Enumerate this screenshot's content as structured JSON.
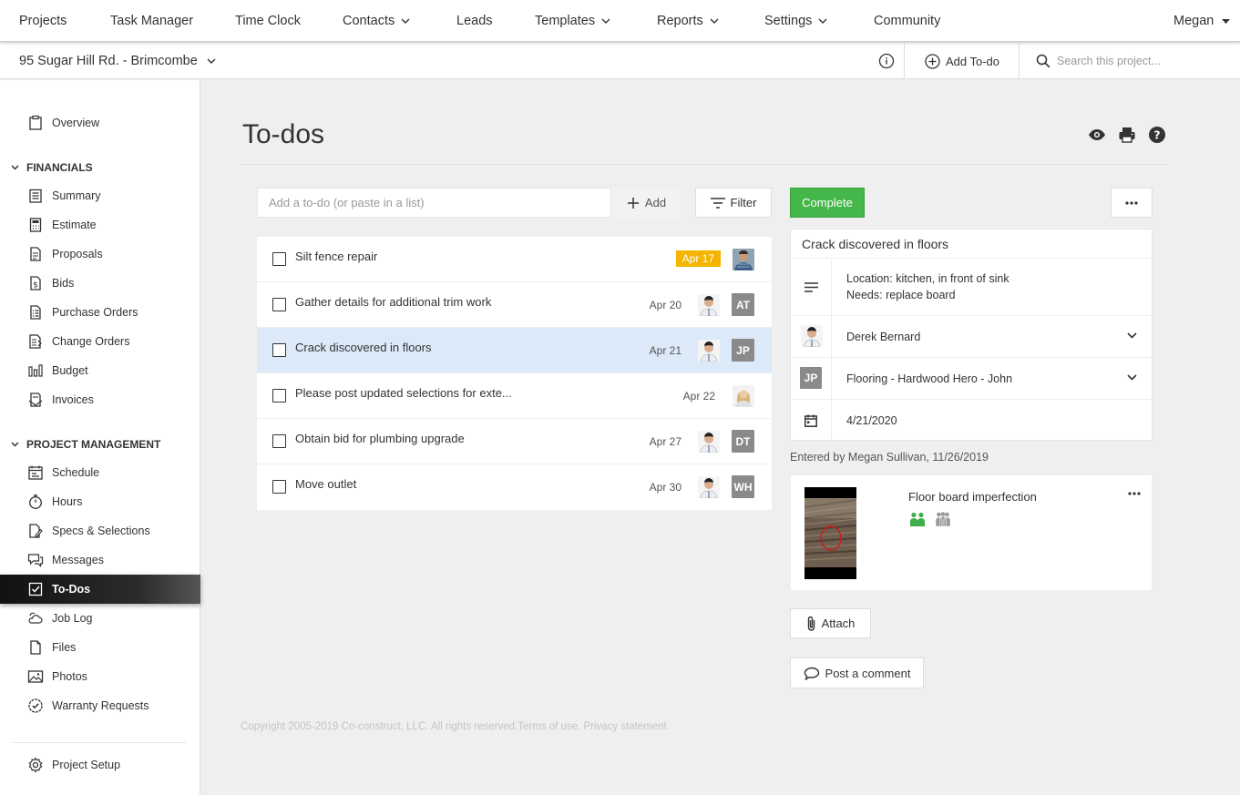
{
  "topnav": {
    "items": [
      "Projects",
      "Task Manager",
      "Time Clock",
      "Contacts",
      "Leads",
      "Templates",
      "Reports",
      "Settings",
      "Community"
    ],
    "user": "Megan"
  },
  "subbar": {
    "project": "95 Sugar Hill Rd. - Brimcombe",
    "add_todo": "Add To-do",
    "search_placeholder": "Search this project..."
  },
  "sidebar": {
    "overview": "Overview",
    "financials_title": "FINANCIALS",
    "financials": [
      "Summary",
      "Estimate",
      "Proposals",
      "Bids",
      "Purchase Orders",
      "Change Orders",
      "Budget",
      "Invoices"
    ],
    "pm_title": "PROJECT MANAGEMENT",
    "pm": [
      "Schedule",
      "Hours",
      "Specs & Selections",
      "Messages",
      "To-Dos",
      "Job Log",
      "Files",
      "Photos",
      "Warranty Requests"
    ],
    "setup": "Project Setup",
    "active": "To-Dos"
  },
  "main": {
    "title": "To-dos",
    "add_placeholder": "Add a to-do (or paste in a list)",
    "add_label": "Add",
    "filter_label": "Filter",
    "todos": [
      {
        "title": "Silt fence repair",
        "date": "Apr 17",
        "overdue": true,
        "avatar": "photo"
      },
      {
        "title": "Gather details for additional trim work",
        "date": "Apr 20",
        "initials": "AT"
      },
      {
        "title": "Crack discovered in floors",
        "date": "Apr 21",
        "initials": "JP",
        "selected": true
      },
      {
        "title": "Please post updated selections for exte...",
        "date": "Apr 22",
        "avatar": "photo"
      },
      {
        "title": "Obtain bid for plumbing upgrade",
        "date": "Apr 27",
        "initials": "DT"
      },
      {
        "title": "Move outlet",
        "date": "Apr 30",
        "initials": "WH"
      }
    ],
    "footer": "Copyright 2005-2019 Co-construct, LLC. All rights reserved.Terms of use. Privacy statement"
  },
  "detail": {
    "complete_label": "Complete",
    "title": "Crack discovered in floors",
    "description_line1": "Location: kitchen, in front of sink",
    "description_line2": "Needs: replace board",
    "assignee": "Derek Bernard",
    "vendor_initials": "JP",
    "vendor": "Flooring - Hardwood Hero - John",
    "due_date": "4/21/2020",
    "entered_by": "Entered by Megan Sullivan, 11/26/2019",
    "attachment_name": "Floor board imperfection",
    "attach_label": "Attach",
    "comment_label": "Post a comment"
  },
  "colors": {
    "complete_green": "#45b649",
    "overdue_badge": "#f5b400",
    "selected_row": "#dbe9f8",
    "share_green": "#3fae49"
  }
}
